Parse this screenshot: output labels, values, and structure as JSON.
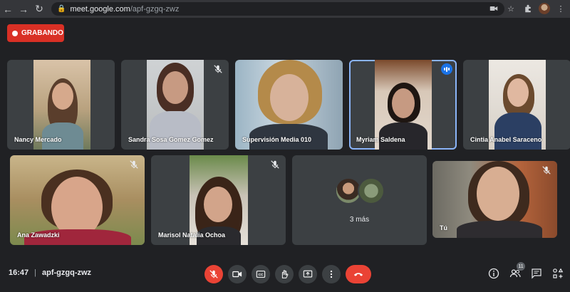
{
  "browser": {
    "url_host": "meet.google.com",
    "url_path": "/apf-gzgq-zwz"
  },
  "recording": {
    "label": "GRABANDO"
  },
  "participants": [
    {
      "name": "Nancy Mercado",
      "muted": false,
      "speaking": false
    },
    {
      "name": "Sandra Sosa Gomez Gomez",
      "muted": true,
      "speaking": false
    },
    {
      "name": "Supervisión Media 010",
      "muted": false,
      "speaking": false
    },
    {
      "name": "Myriam Saldena",
      "muted": false,
      "speaking": true
    },
    {
      "name": "Cintia Anabel Saraceno",
      "muted": false,
      "speaking": false
    },
    {
      "name": "Ana Zawadzki",
      "muted": true,
      "speaking": false
    },
    {
      "name": "Marisol Natalia Ochoa",
      "muted": true,
      "speaking": false
    },
    {
      "name": "Tú",
      "muted": true,
      "speaking": false
    }
  ],
  "more_tile": {
    "label": "3 más"
  },
  "meeting": {
    "time": "16:47",
    "code": "apf-gzgq-zwz",
    "participant_count": "11"
  },
  "controls": [
    {
      "name": "microphone",
      "icon": "mic-off-icon",
      "state": "off"
    },
    {
      "name": "camera",
      "icon": "camera-icon"
    },
    {
      "name": "captions",
      "icon": "captions-icon"
    },
    {
      "name": "raise-hand",
      "icon": "hand-icon"
    },
    {
      "name": "present",
      "icon": "present-icon"
    },
    {
      "name": "more-options",
      "icon": "more-vert-icon"
    },
    {
      "name": "leave-call",
      "icon": "hangup-icon"
    }
  ],
  "colors": {
    "background": "#202124",
    "tile": "#3c4043",
    "record": "#d93025",
    "hangup": "#ea4335",
    "active_outline": "#8ab4f8",
    "speaking": "#1a73e8"
  }
}
